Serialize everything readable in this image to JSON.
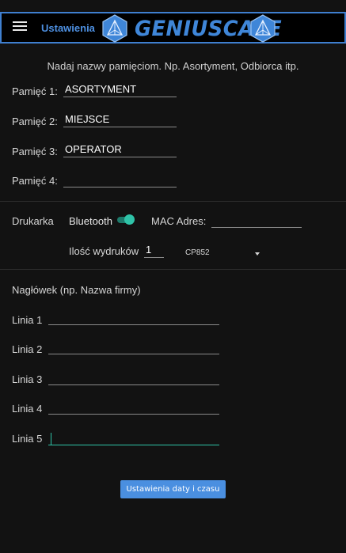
{
  "app_bar": {
    "title": "Ustawienia",
    "logo_text": "GENIUSCALE"
  },
  "intro": "Nadaj nazwy pamięciom. Np. Asortyment, Odbiorca itp.",
  "memories": [
    {
      "label": "Pamięć 1:",
      "value": "ASORTYMENT"
    },
    {
      "label": "Pamięć 2:",
      "value": "MIEJSCE"
    },
    {
      "label": "Pamięć 3:",
      "value": "OPERATOR"
    },
    {
      "label": "Pamięć 4:",
      "value": ""
    }
  ],
  "printer": {
    "label": "Drukarka",
    "bluetooth_label": "Bluetooth",
    "bluetooth_enabled": true,
    "mac_label": "MAC Adres:",
    "mac_value": "",
    "copies_label": "Ilość wydruków",
    "copies_value": "1",
    "codepage_value": "CP852"
  },
  "header": {
    "title": "Nagłówek (np. Nazwa firmy)",
    "lines": [
      {
        "label": "Linia 1",
        "value": ""
      },
      {
        "label": "Linia 2",
        "value": ""
      },
      {
        "label": "Linia 3",
        "value": ""
      },
      {
        "label": "Linia 4",
        "value": ""
      },
      {
        "label": "Linia 5",
        "value": ""
      }
    ]
  },
  "date_button_label": "Ustawienia daty i czasu",
  "colors": {
    "accent_blue": "#4a8fe0",
    "accent_teal": "#2fc3a8",
    "background": "#121212"
  }
}
